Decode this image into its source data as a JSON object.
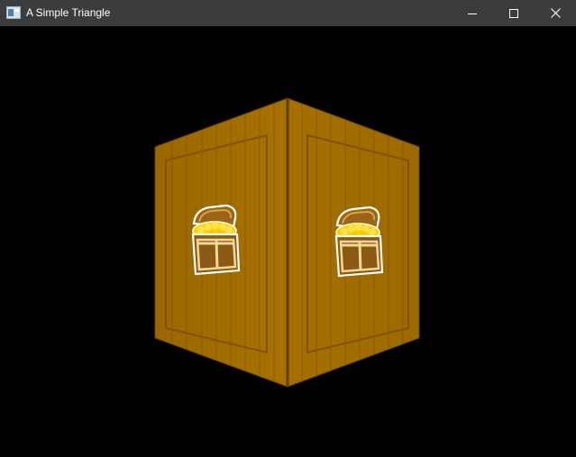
{
  "window": {
    "title": "A Simple Triangle",
    "icons": {
      "app": "window-app-icon",
      "minimize": "minimize-icon",
      "maximize": "maximize-icon",
      "close": "close-icon"
    },
    "colors": {
      "titlebar": "#3c3c3c",
      "titlebar_text": "#ffffff",
      "viewport_bg": "#000000"
    }
  },
  "scene": {
    "object": "wooden-crate",
    "face_icon": "treasure-chest-icon",
    "colors": {
      "wood": "#a06c00",
      "wood_dark": "#7a5000",
      "wood_line": "#6b4600",
      "chest_gold": "#ffd200",
      "chest_wood": "#8a5a12"
    }
  }
}
